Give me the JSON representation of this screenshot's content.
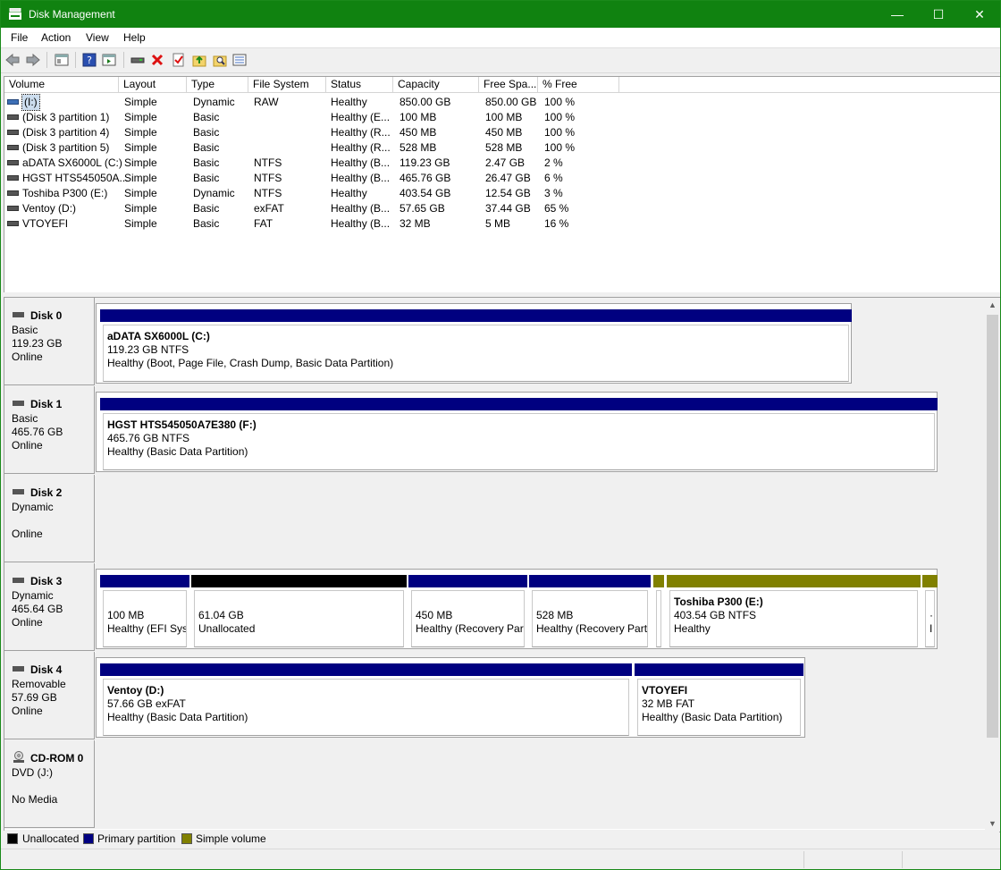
{
  "window": {
    "title": "Disk Management",
    "controls": {
      "minimize": "—",
      "maximize": "☐",
      "close": "✕"
    }
  },
  "menu": [
    "File",
    "Action",
    "View",
    "Help"
  ],
  "colors": {
    "titlebar": "#108210",
    "primary": "#000080",
    "unallocated": "#000000",
    "simple": "#808000"
  },
  "volume_list": {
    "columns": [
      "Volume",
      "Layout",
      "Type",
      "File System",
      "Status",
      "Capacity",
      "Free Spa...",
      "% Free"
    ],
    "rows": [
      [
        "(I:)",
        "Simple",
        "Dynamic",
        "RAW",
        "Healthy",
        "850.00 GB",
        "850.00 GB",
        "100 %"
      ],
      [
        "(Disk 3 partition 1)",
        "Simple",
        "Basic",
        "",
        "Healthy (E...",
        "100 MB",
        "100 MB",
        "100 %"
      ],
      [
        "(Disk 3 partition 4)",
        "Simple",
        "Basic",
        "",
        "Healthy (R...",
        "450 MB",
        "450 MB",
        "100 %"
      ],
      [
        "(Disk 3 partition 5)",
        "Simple",
        "Basic",
        "",
        "Healthy (R...",
        "528 MB",
        "528 MB",
        "100 %"
      ],
      [
        "aDATA SX6000L (C:)",
        "Simple",
        "Basic",
        "NTFS",
        "Healthy (B...",
        "119.23 GB",
        "2.47 GB",
        "2 %"
      ],
      [
        "HGST HTS545050A...",
        "Simple",
        "Basic",
        "NTFS",
        "Healthy (B...",
        "465.76 GB",
        "26.47 GB",
        "6 %"
      ],
      [
        "Toshiba P300 (E:)",
        "Simple",
        "Dynamic",
        "NTFS",
        "Healthy",
        "403.54 GB",
        "12.54 GB",
        "3 %"
      ],
      [
        "Ventoy (D:)",
        "Simple",
        "Basic",
        "exFAT",
        "Healthy (B...",
        "57.65 GB",
        "37.44 GB",
        "65 %"
      ],
      [
        "VTOYEFI",
        "Simple",
        "Basic",
        "FAT",
        "Healthy (B...",
        "32 MB",
        "5 MB",
        "16 %"
      ]
    ]
  },
  "disks": [
    {
      "name": "Disk 0",
      "l1": "Basic",
      "l2": "119.23 GB",
      "l3": "Online",
      "partitions": [
        {
          "title": "aDATA SX6000L  (C:)",
          "size": "119.23 GB NTFS",
          "status": "Healthy (Boot, Page File, Crash Dump, Basic Data Partition)",
          "color": "primary"
        }
      ]
    },
    {
      "name": "Disk 1",
      "l1": "Basic",
      "l2": "465.76 GB",
      "l3": "Online",
      "partitions": [
        {
          "title": "HGST HTS545050A7E380  (F:)",
          "size": "465.76 GB NTFS",
          "status": "Healthy (Basic Data Partition)",
          "color": "primary"
        }
      ]
    },
    {
      "name": "Disk 2",
      "l1": "Dynamic",
      "l2": "",
      "l3": "Online",
      "partitions": []
    },
    {
      "name": "Disk 3",
      "l1": "Dynamic",
      "l2": "465.64 GB",
      "l3": "Online",
      "partitions": [
        {
          "title": "",
          "size": "100 MB",
          "status": "Healthy (EFI Syst",
          "color": "primary"
        },
        {
          "title": "",
          "size": "61.04 GB",
          "status": "Unallocated",
          "color": "unallocated"
        },
        {
          "title": "",
          "size": "450 MB",
          "status": "Healthy (Recovery Part",
          "color": "primary"
        },
        {
          "title": "",
          "size": "528 MB",
          "status": "Healthy (Recovery Parti",
          "color": "primary"
        },
        {
          "title": "",
          "size": "",
          "status": "",
          "color": "simple"
        },
        {
          "title": "Toshiba P300  (E:)",
          "size": "403.54 GB NTFS",
          "status": "Healthy",
          "color": "simple"
        },
        {
          "title": "",
          "size": "·",
          "status": "I",
          "color": "simple"
        }
      ]
    },
    {
      "name": "Disk 4",
      "l1": "Removable",
      "l2": "57.69 GB",
      "l3": "Online",
      "partitions": [
        {
          "title": "Ventoy  (D:)",
          "size": "57.66 GB exFAT",
          "status": "Healthy (Basic Data Partition)",
          "color": "primary"
        },
        {
          "title": "VTOYEFI",
          "size": "32 MB FAT",
          "status": "Healthy (Basic Data Partition)",
          "color": "primary"
        }
      ]
    },
    {
      "name": "CD-ROM 0",
      "l1": "DVD (J:)",
      "l2": "",
      "l3": "No Media",
      "partitions": []
    }
  ],
  "legend": [
    {
      "label": "Unallocated",
      "color": "#000000"
    },
    {
      "label": "Primary partition",
      "color": "#000080"
    },
    {
      "label": "Simple volume",
      "color": "#808000"
    }
  ]
}
